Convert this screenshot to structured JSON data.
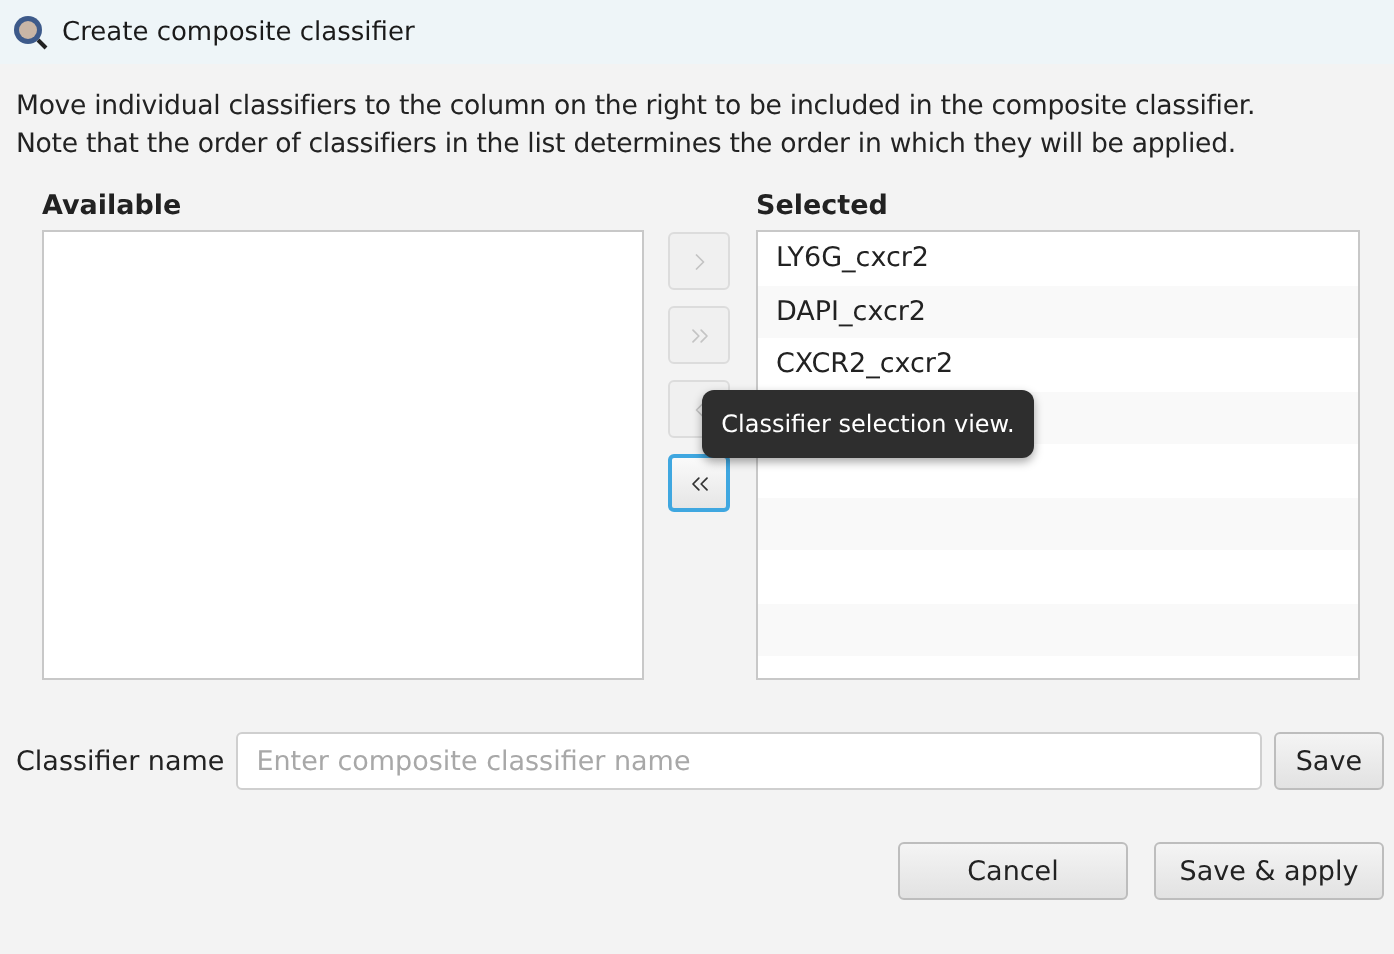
{
  "window": {
    "title": "Create composite classifier"
  },
  "description": [
    "Move individual classifiers to the column on the right to be included in the composite classifier.",
    "Note that the order of classifiers in the list determines the order in which they will be applied."
  ],
  "available": {
    "heading": "Available"
  },
  "move_buttons": [
    {
      "kind": "right",
      "disabled": true,
      "focused": false
    },
    {
      "kind": "all_right",
      "disabled": true,
      "focused": false
    },
    {
      "kind": "left",
      "disabled": true,
      "focused": false
    },
    {
      "kind": "all_left",
      "disabled": false,
      "focused": true
    }
  ],
  "selected": {
    "heading": "Selected",
    "items": [
      "LY6G_cxcr2",
      "DAPI_cxcr2",
      "CXCR2_cxcr2"
    ]
  },
  "tooltip": "Classifier selection view.",
  "name_field": {
    "label": "Classifier name",
    "placeholder": "Enter composite classifier name",
    "button": "Save"
  },
  "buttons": [
    "Cancel",
    "Save & apply"
  ]
}
